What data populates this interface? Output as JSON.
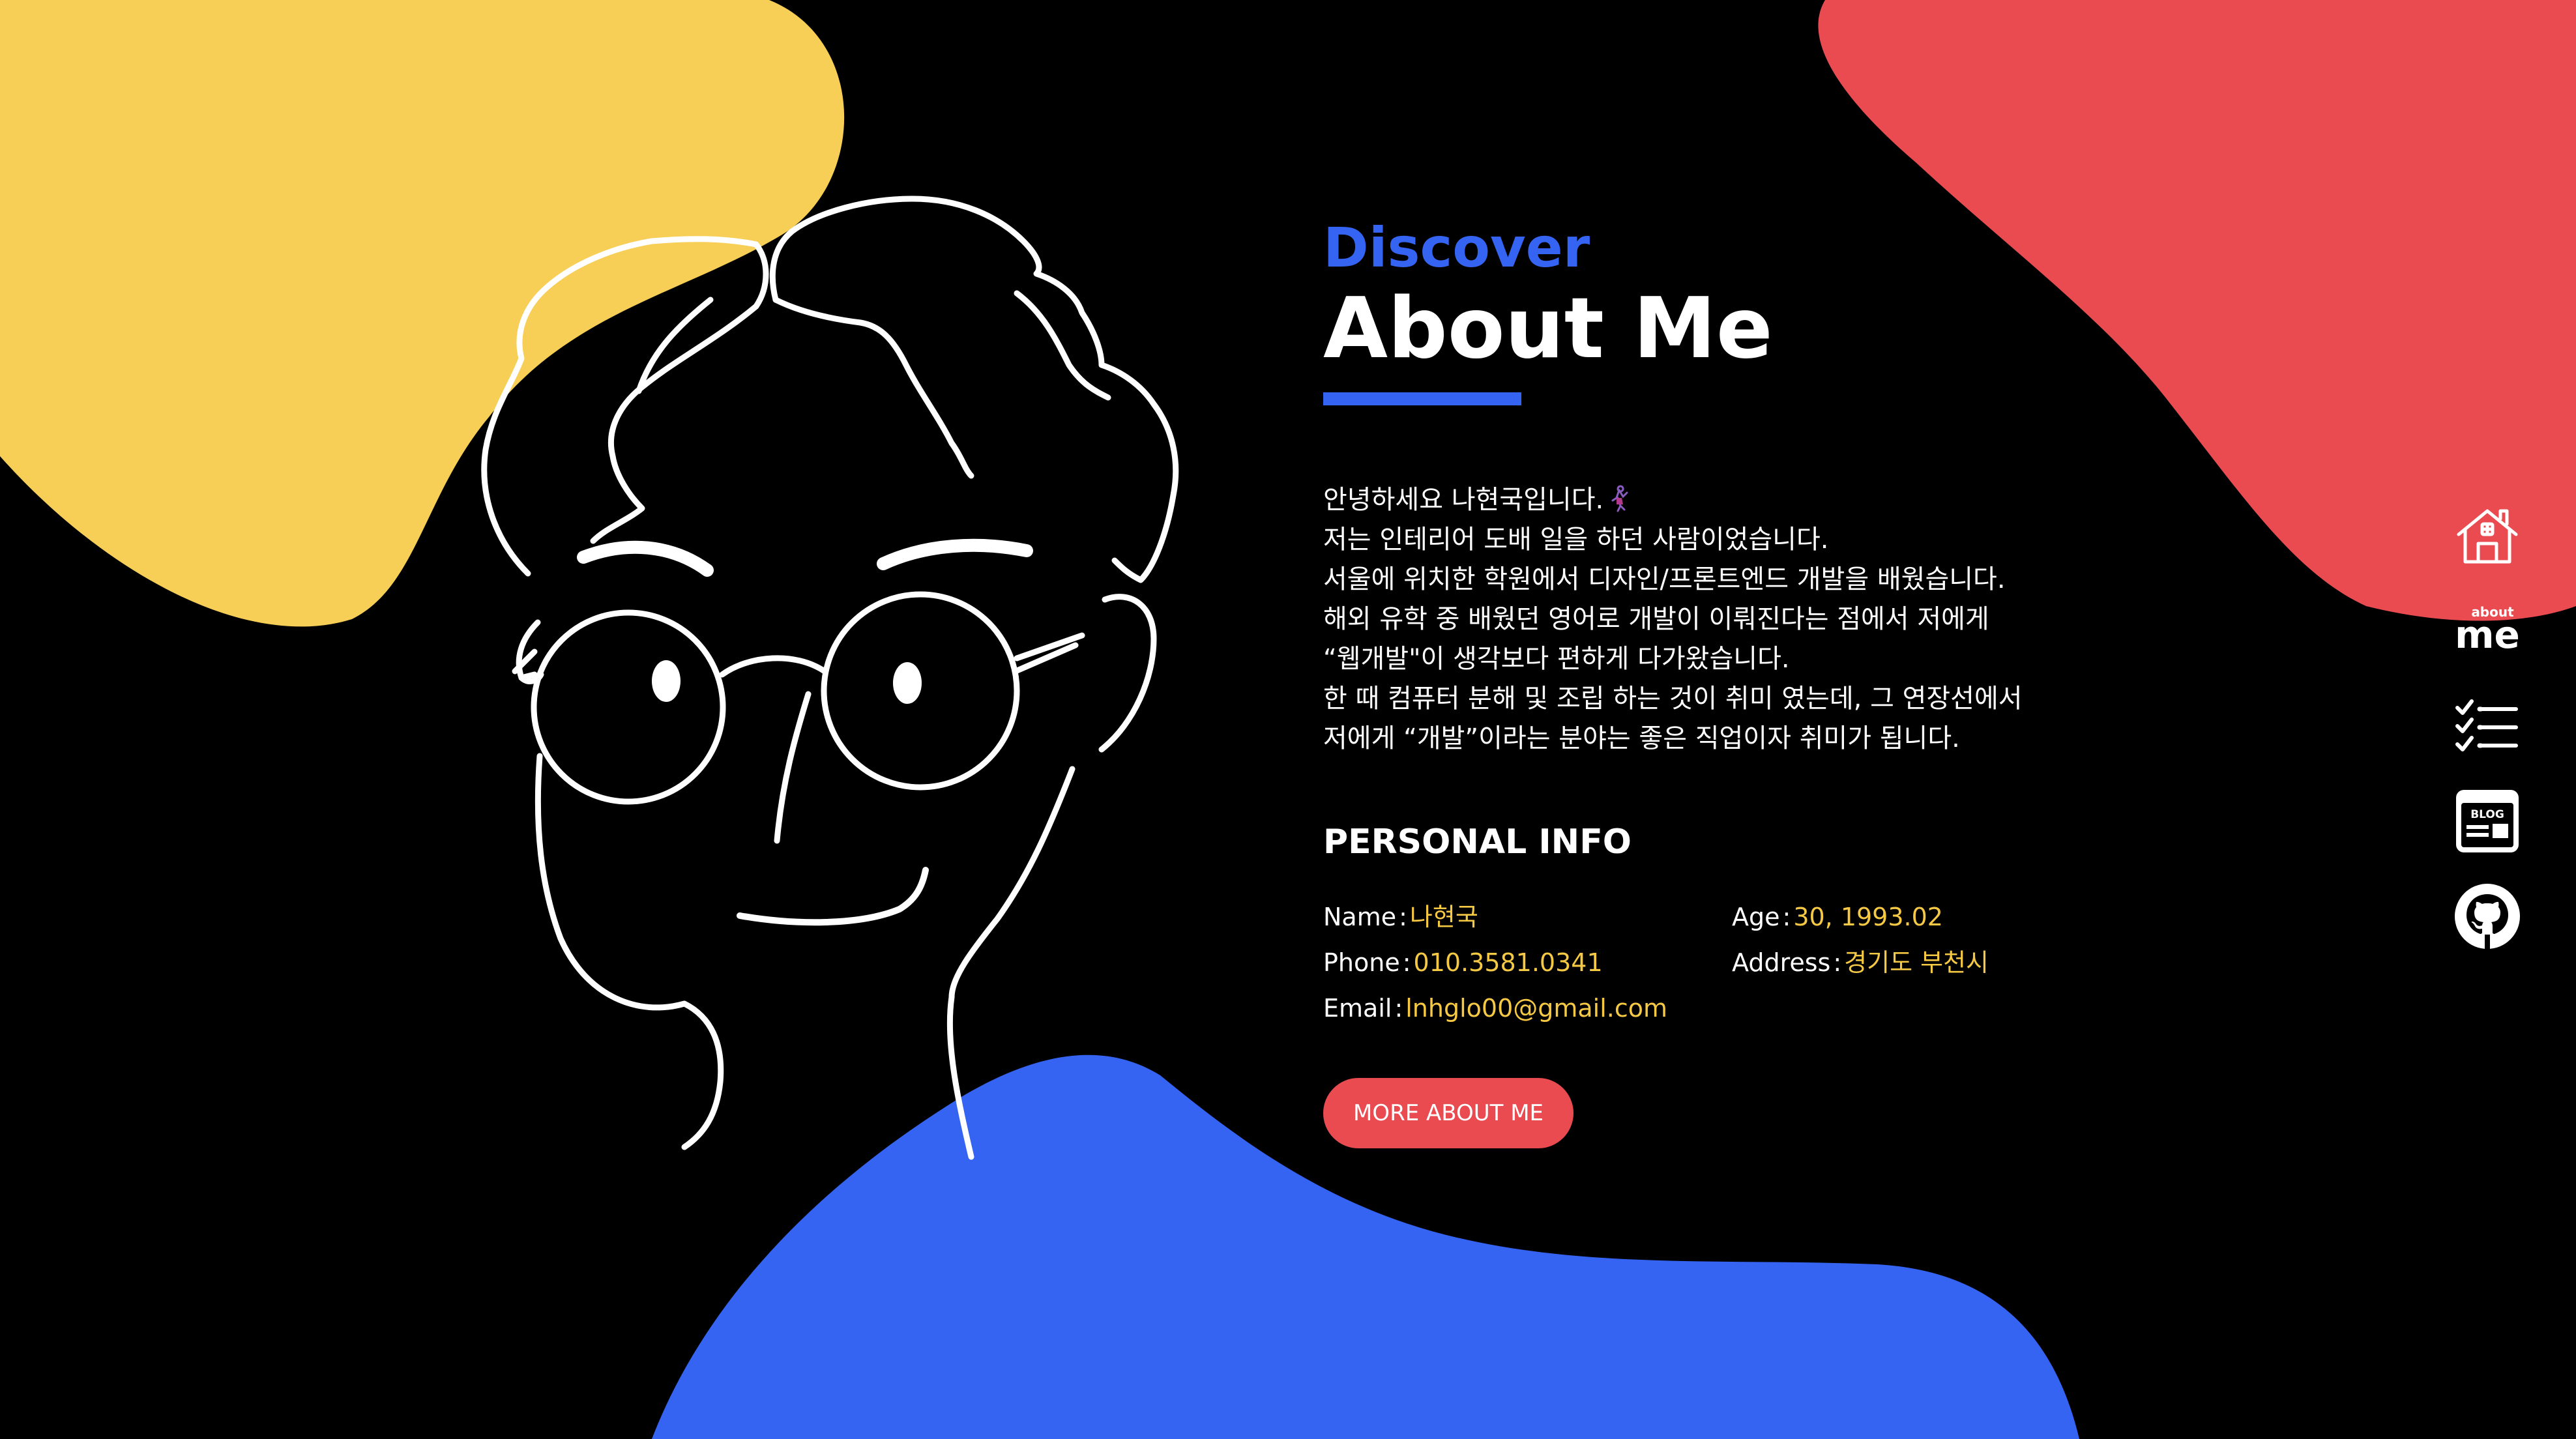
{
  "colors": {
    "background": "#000000",
    "yellow_blob": "#f7cf57",
    "red_blob": "#e94b51",
    "blue_blob": "#3564f2",
    "accent_blue": "#3564f2",
    "button": "#e94b51",
    "info_value": "#f6c945",
    "text": "#ffffff"
  },
  "header": {
    "kicker": "Discover",
    "title": "About Me"
  },
  "intro": {
    "lines": [
      "안녕하세요 나현국입니다.",
      "저는 인테리어 도배 일을 하던 사람이었습니다.",
      "서울에 위치한 학원에서 디자인/프론트엔드 개발을 배웠습니다.",
      "해외 유학 중 배웠던 영어로 개발이 이뤄진다는 점에서 저에게",
      "“웹개발\"이 생각보다 편하게 다가왔습니다.",
      "한 때 컴퓨터 분해 및 조립 하는 것이 취미 였는데, 그 연장선에서",
      "저에게 “개발”이라는 분야는 좋은 직업이자 취미가 됩니다."
    ],
    "emoji_icon": "dancer-emoji-icon"
  },
  "personal_info": {
    "title": "PERSONAL INFO",
    "separator": ":",
    "name": {
      "label": "Name",
      "value": "나현국"
    },
    "age": {
      "label": "Age",
      "value": "30, 1993.02"
    },
    "phone": {
      "label": "Phone",
      "value": "010.3581.0341"
    },
    "address": {
      "label": "Address",
      "value": "경기도 부천시"
    },
    "email": {
      "label": "Email",
      "value": "lnhglo00@gmail.com"
    }
  },
  "cta": {
    "label": "MORE ABOUT ME"
  },
  "sidenav": {
    "items": [
      {
        "icon": "home-icon"
      },
      {
        "icon": "about-me-icon",
        "text_small": "about",
        "text_large": "me"
      },
      {
        "icon": "checklist-icon"
      },
      {
        "icon": "blog-icon",
        "text": "BLOG"
      },
      {
        "icon": "github-icon"
      }
    ]
  }
}
